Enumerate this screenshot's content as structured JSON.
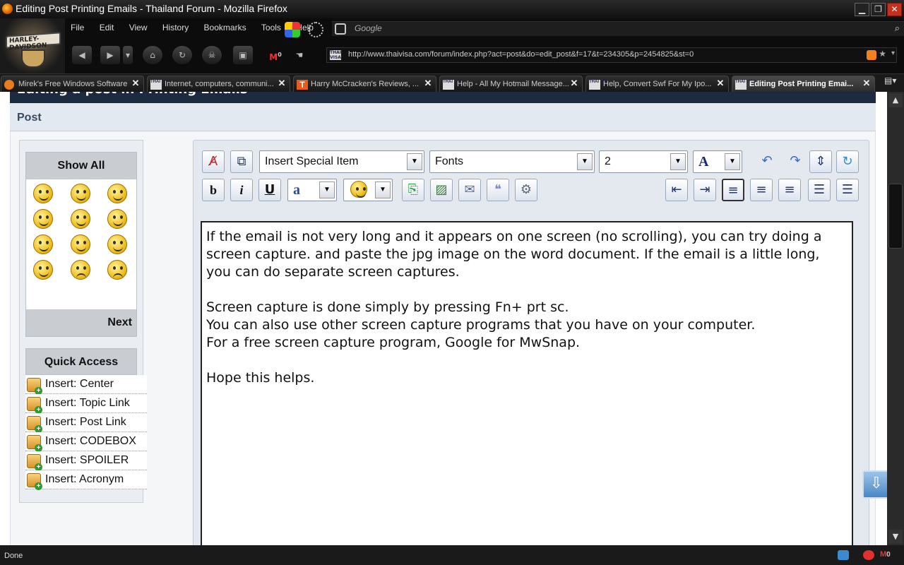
{
  "window": {
    "title": "Editing Post Printing Emails - Thailand Forum - Mozilla Firefox"
  },
  "logo": {
    "text": "HARLEY-DAVIDSON"
  },
  "menu": [
    "File",
    "Edit",
    "View",
    "History",
    "Bookmarks",
    "Tools",
    "Help"
  ],
  "search": {
    "placeholder": "Google"
  },
  "gmail_count": "0",
  "url": "http://www.thaivisa.com/forum/index.php?act=post&do=edit_post&f=17&t=234305&p=2454825&st=0",
  "favicon_text": "THAI VISA",
  "tabs": [
    {
      "label": "Mirek's Free Windows Software",
      "favicon": "orange"
    },
    {
      "label": "Internet, computers, communi...",
      "favicon": "thaivisa"
    },
    {
      "label": "Harry McCracken's Reviews, ...",
      "favicon": "T"
    },
    {
      "label": "Help - All My Hotmail Message...",
      "favicon": "thaivisa"
    },
    {
      "label": "Help, Convert Swf For My Ipo...",
      "favicon": "thaivisa"
    },
    {
      "label": "Editing Post Printing Emai...",
      "favicon": "thaivisa",
      "active": true
    }
  ],
  "page": {
    "heading": "Editing a post in Printing Emails",
    "section": "Post"
  },
  "emoticons": {
    "show_all": "Show All",
    "next": "Next"
  },
  "quick_access": {
    "title": "Quick Access",
    "items": [
      "Insert: Center",
      "Insert: Topic Link",
      "Insert: Post Link",
      "Insert: CODEBOX",
      "Insert: SPOILER",
      "Insert: Acronym"
    ]
  },
  "toolbar": {
    "special_item": "Insert Special Item",
    "fonts": "Fonts",
    "size": "2",
    "font_color_glyph": "A",
    "bold": "b",
    "italic": "i",
    "underline": "U",
    "font_style_glyph": "a"
  },
  "post_text": "If the email is not very long and it appears on one screen (no scrolling), you can try doing a screen capture. and paste the jpg image on the word document. If the email is a little long, you can do separate screen captures.\n\nScreen capture is done simply by pressing Fn+ prt sc.\nYou can also use other screen capture programs that you have on your computer.\nFor a free screen capture program, Google for MwSnap.\n\nHope this helps.",
  "status": {
    "text": "Done",
    "gmail_count": "0"
  }
}
